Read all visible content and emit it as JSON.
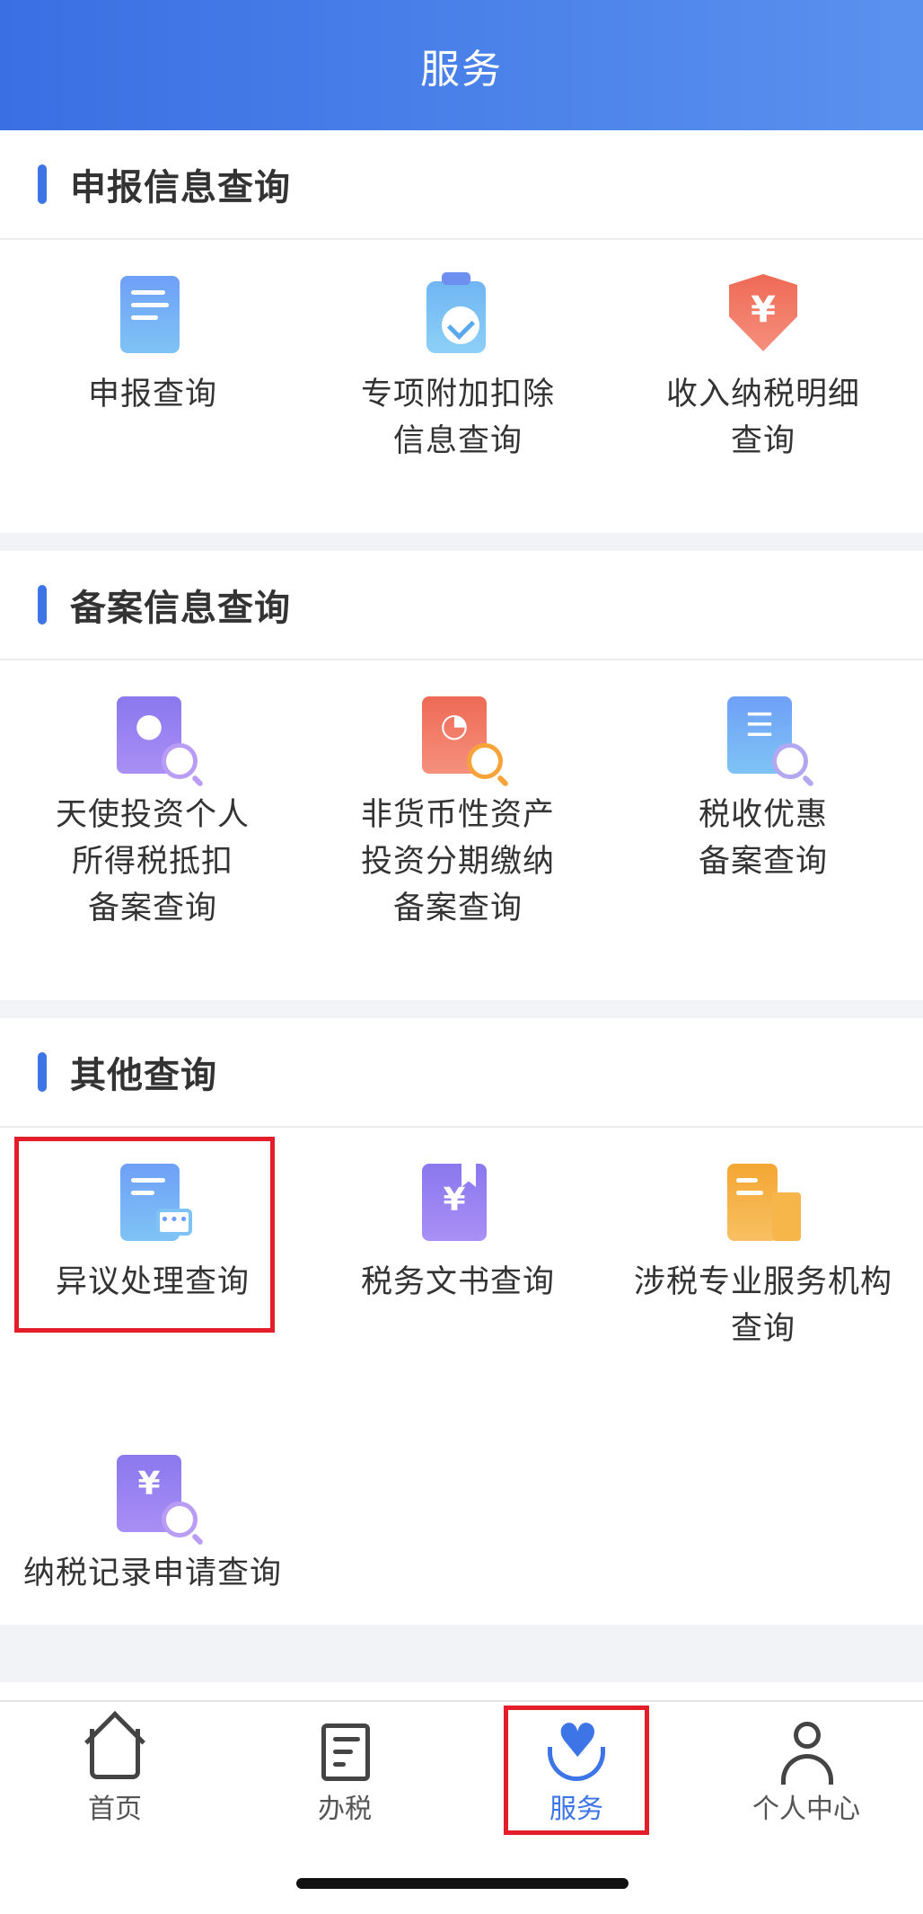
{
  "header": {
    "title": "服务"
  },
  "sections": [
    {
      "title": "申报信息查询",
      "items": [
        {
          "lines": [
            "申报查询"
          ],
          "icon": "document-icon"
        },
        {
          "lines": [
            "专项附加扣除",
            "信息查询"
          ],
          "icon": "clipboard-check-icon"
        },
        {
          "lines": [
            "收入纳税明细",
            "查询"
          ],
          "icon": "yuan-shield-icon"
        }
      ]
    },
    {
      "title": "备案信息查询",
      "items": [
        {
          "lines": [
            "天使投资个人",
            "所得税抵扣",
            "备案查询"
          ],
          "icon": "person-search-icon"
        },
        {
          "lines": [
            "非货币性资产",
            "投资分期缴纳",
            "备案查询"
          ],
          "icon": "pie-search-icon"
        },
        {
          "lines": [
            "税收优惠",
            "备案查询"
          ],
          "icon": "list-search-icon"
        }
      ]
    },
    {
      "title": "其他查询",
      "items": [
        {
          "lines": [
            "异议处理查询"
          ],
          "icon": "document-chat-icon"
        },
        {
          "lines": [
            "税务文书查询"
          ],
          "icon": "yuan-bookmark-icon"
        },
        {
          "lines": [
            "涉税专业服务机构",
            "查询"
          ],
          "icon": "building-docs-icon"
        },
        {
          "lines": [
            "纳税记录申请查询"
          ],
          "icon": "yuan-search-icon"
        }
      ]
    }
  ],
  "tabbar": {
    "items": [
      {
        "label": "首页",
        "icon": "home-icon"
      },
      {
        "label": "办税",
        "icon": "tax-form-icon"
      },
      {
        "label": "服务",
        "icon": "heart-hands-icon",
        "active": true
      },
      {
        "label": "个人中心",
        "icon": "person-icon"
      }
    ]
  },
  "colors": {
    "accent": "#3d74e6",
    "highlight": "#e41d2b"
  }
}
